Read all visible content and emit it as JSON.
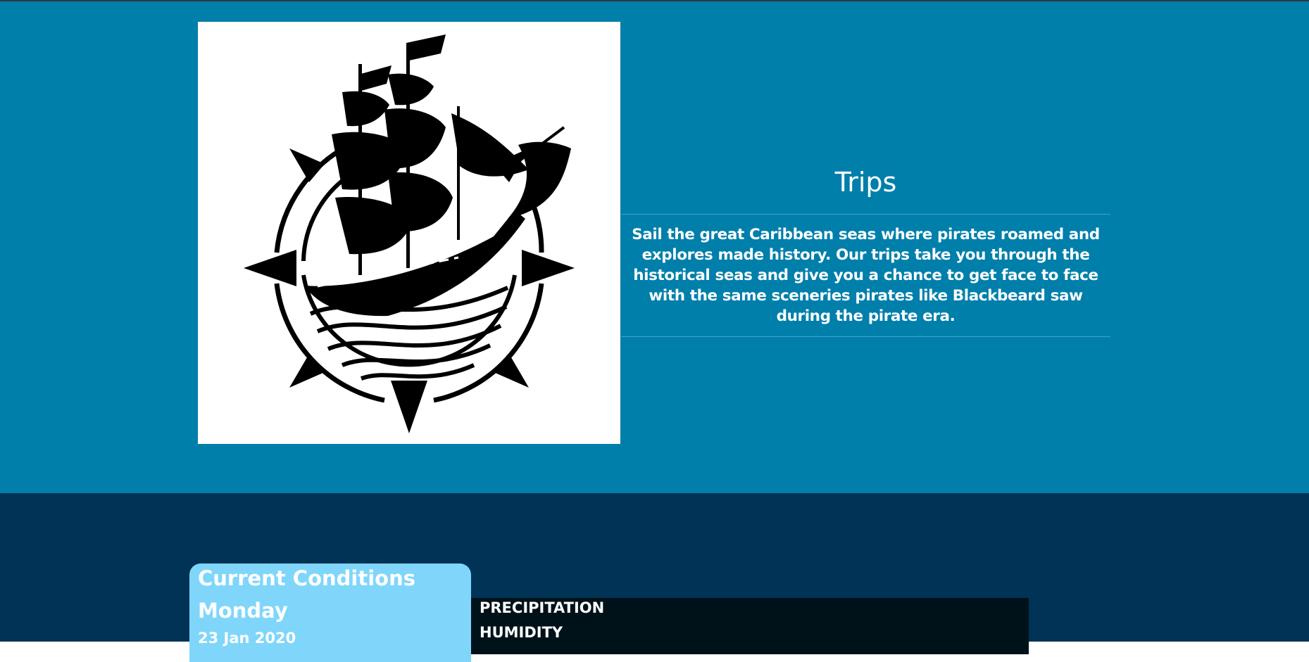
{
  "trips": {
    "logo_icon": "pirate-ship-compass-logo",
    "title": "Trips",
    "description": "Sail the great Caribbean seas where pirates roamed and explores made history. Our trips take you through the historical seas and give you a chance to get face to face with the same sceneries pirates like Blackbeard saw during the pirate era."
  },
  "weather": {
    "card_title": "Current Conditions",
    "day": "Monday",
    "date": "23 Jan 2020",
    "metrics": [
      "PRECIPITATION",
      "HUMIDITY"
    ]
  },
  "colors": {
    "trips_background": "#007fab",
    "weather_background": "#003355",
    "card_background": "#7fd6fa",
    "metrics_background": "#001219",
    "text": "#ffffff"
  }
}
